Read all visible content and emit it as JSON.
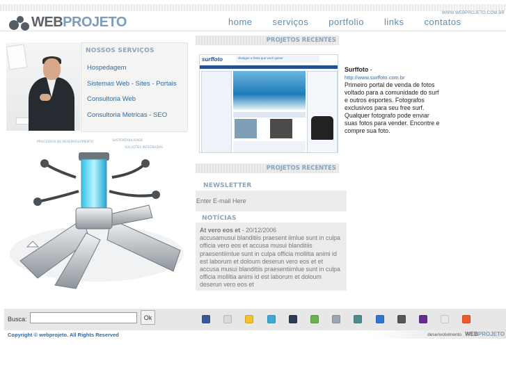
{
  "header": {
    "logo_part1": "WEB",
    "logo_part2": "PROJETO",
    "site_url": "WWW.WEBPROJETO.COM.BR",
    "nav": [
      "home",
      "serviços",
      "portfolio",
      "links",
      "contatos"
    ]
  },
  "services": {
    "title": "Nossos Serviços",
    "items": [
      "Hospedagem",
      "Sistemas Web - Sites - Portais",
      "Consultoria Web",
      "Consultoria Metricas - SEO"
    ]
  },
  "projects": {
    "title": "Projetos Recentes",
    "title_bottom": "Projetos Recentes",
    "featured": {
      "name": "Surffoto",
      "separator": " -",
      "url": "http://www.surffoto.com.br",
      "description": "Primeiro portal de venda de fotos voltado para a comunidade do surf e outros esportes. Fotografos exclusivos para seu free surf. Qualquer fotografo pode enviar suas fotos para vender. Encontre e compre sua foto.",
      "screenshot_logo": "surffoto",
      "screenshot_banner": "divulgue a fotos que você quiser"
    }
  },
  "newsletter": {
    "title": "Newsletter",
    "placeholder": "Enter E-mail Here"
  },
  "news": {
    "title": "Notícias",
    "item_title": "At vero eos et",
    "item_date": " - 20/12/2006",
    "item_body": "accusamusui blanditiis praesent iimlue sunt in culpa officia vero eos et accusa musui blanditiis praesentiimlue sunt in culpa officia mollitia animi id est laborum et doloum deserun vero eos et et accusa musui blanditiis praesentiimlue sunt in culpa officia mollitia animi id est laborum et doloum deserun vero eos et"
  },
  "search": {
    "label": "Busca:",
    "button": "Ok"
  },
  "social_icons": [
    {
      "name": "facebook-icon",
      "color": "#3b5998"
    },
    {
      "name": "email-icon",
      "color": "#d9d9d9"
    },
    {
      "name": "favorites-icon",
      "color": "#f2c12e"
    },
    {
      "name": "twitter-icon",
      "color": "#3fa9d6"
    },
    {
      "name": "myspace-icon",
      "color": "#2b3a55"
    },
    {
      "name": "google-icon",
      "color": "#6bb04d"
    },
    {
      "name": "digg-icon",
      "color": "#9aa6b2"
    },
    {
      "name": "stumbleupon-icon",
      "color": "#4c8c8c"
    },
    {
      "name": "delicious-icon",
      "color": "#3274d1"
    },
    {
      "name": "print-icon",
      "color": "#555555"
    },
    {
      "name": "yahoo-icon",
      "color": "#6b2c91"
    },
    {
      "name": "live-icon",
      "color": "#e8e8e8"
    },
    {
      "name": "addthis-icon",
      "color": "#f1592a"
    }
  ],
  "footer": {
    "copyright": "Copyright © webprojeto. All Rights Reserved",
    "dev_label": "desenvolvimento",
    "dev_logo_part1": "WEB",
    "dev_logo_part2": "PROJETO"
  },
  "machine_labels": [
    "PROCESSOS DE DESENVOLVIMENTO",
    "SUSTENTABILIDADE",
    "SOLUÇÕES INTEGRADAS"
  ]
}
